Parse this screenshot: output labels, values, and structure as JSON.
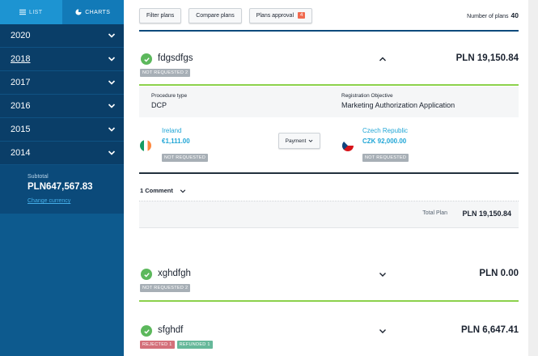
{
  "sidebar": {
    "tabs": [
      {
        "label": "LIST",
        "icon": "list-icon"
      },
      {
        "label": "CHARTS",
        "icon": "pie-chart-icon"
      }
    ],
    "years": [
      {
        "label": "2020",
        "icon": "chevron-down-icon"
      },
      {
        "label": "2018",
        "icon": "chevron-down-icon"
      },
      {
        "label": "2017",
        "icon": "chevron-down-icon"
      },
      {
        "label": "2016",
        "icon": "chevron-down-icon"
      },
      {
        "label": "2015",
        "icon": "chevron-down-icon"
      },
      {
        "label": "2014",
        "icon": "chevron-down-icon"
      }
    ],
    "subtotal": {
      "label": "Subtotal",
      "value": "PLN647,567.83",
      "link": "Change currency"
    }
  },
  "toolbar": {
    "filter_label": "Filter plans",
    "compare_label": "Compare plans",
    "approval_label": "Plans approval",
    "approval_badge": "4",
    "count_label": "Number of plans",
    "count_value": "40"
  },
  "plans": [
    {
      "name": "fdgsdfgs",
      "amount": "PLN 19,150.84",
      "tags": [
        "NOT REQUESTED 2"
      ],
      "expanded": true,
      "details": {
        "procedure_label": "Procedure type",
        "procedure_value": "DCP",
        "objective_label": "Registration Objective",
        "objective_value": "Marketing Authorization Application"
      },
      "countries": [
        {
          "name": "Ireland",
          "amount": "€1,111.00",
          "tag": "NOT REQUESTED",
          "flag": "ireland-flag-icon"
        },
        {
          "name": "Czech Republic",
          "amount": "CZK 92,000.00",
          "tag": "NOT REQUESTED",
          "flag": "czech-flag-icon"
        }
      ],
      "payment_label": "Payment",
      "comments_label": "1 Comment",
      "total_label": "Total Plan",
      "total_value": "PLN 19,150.84"
    },
    {
      "name": "xghdfgh",
      "amount": "PLN 0.00",
      "tags": [
        "NOT REQUESTED 2"
      ]
    },
    {
      "name": "sfghdf",
      "amount": "PLN 6,647.41",
      "tags": [
        "REJECTED 1",
        "REFUNDED 1"
      ]
    }
  ],
  "colors": {
    "sidebar_bg": "#0d5a8e",
    "years_bg": "#0a3e68",
    "accent_blue": "#21a6d6",
    "success_green": "#5cb85c",
    "rule_green": "#8cd14c",
    "badge_orange": "#f06a4f"
  }
}
